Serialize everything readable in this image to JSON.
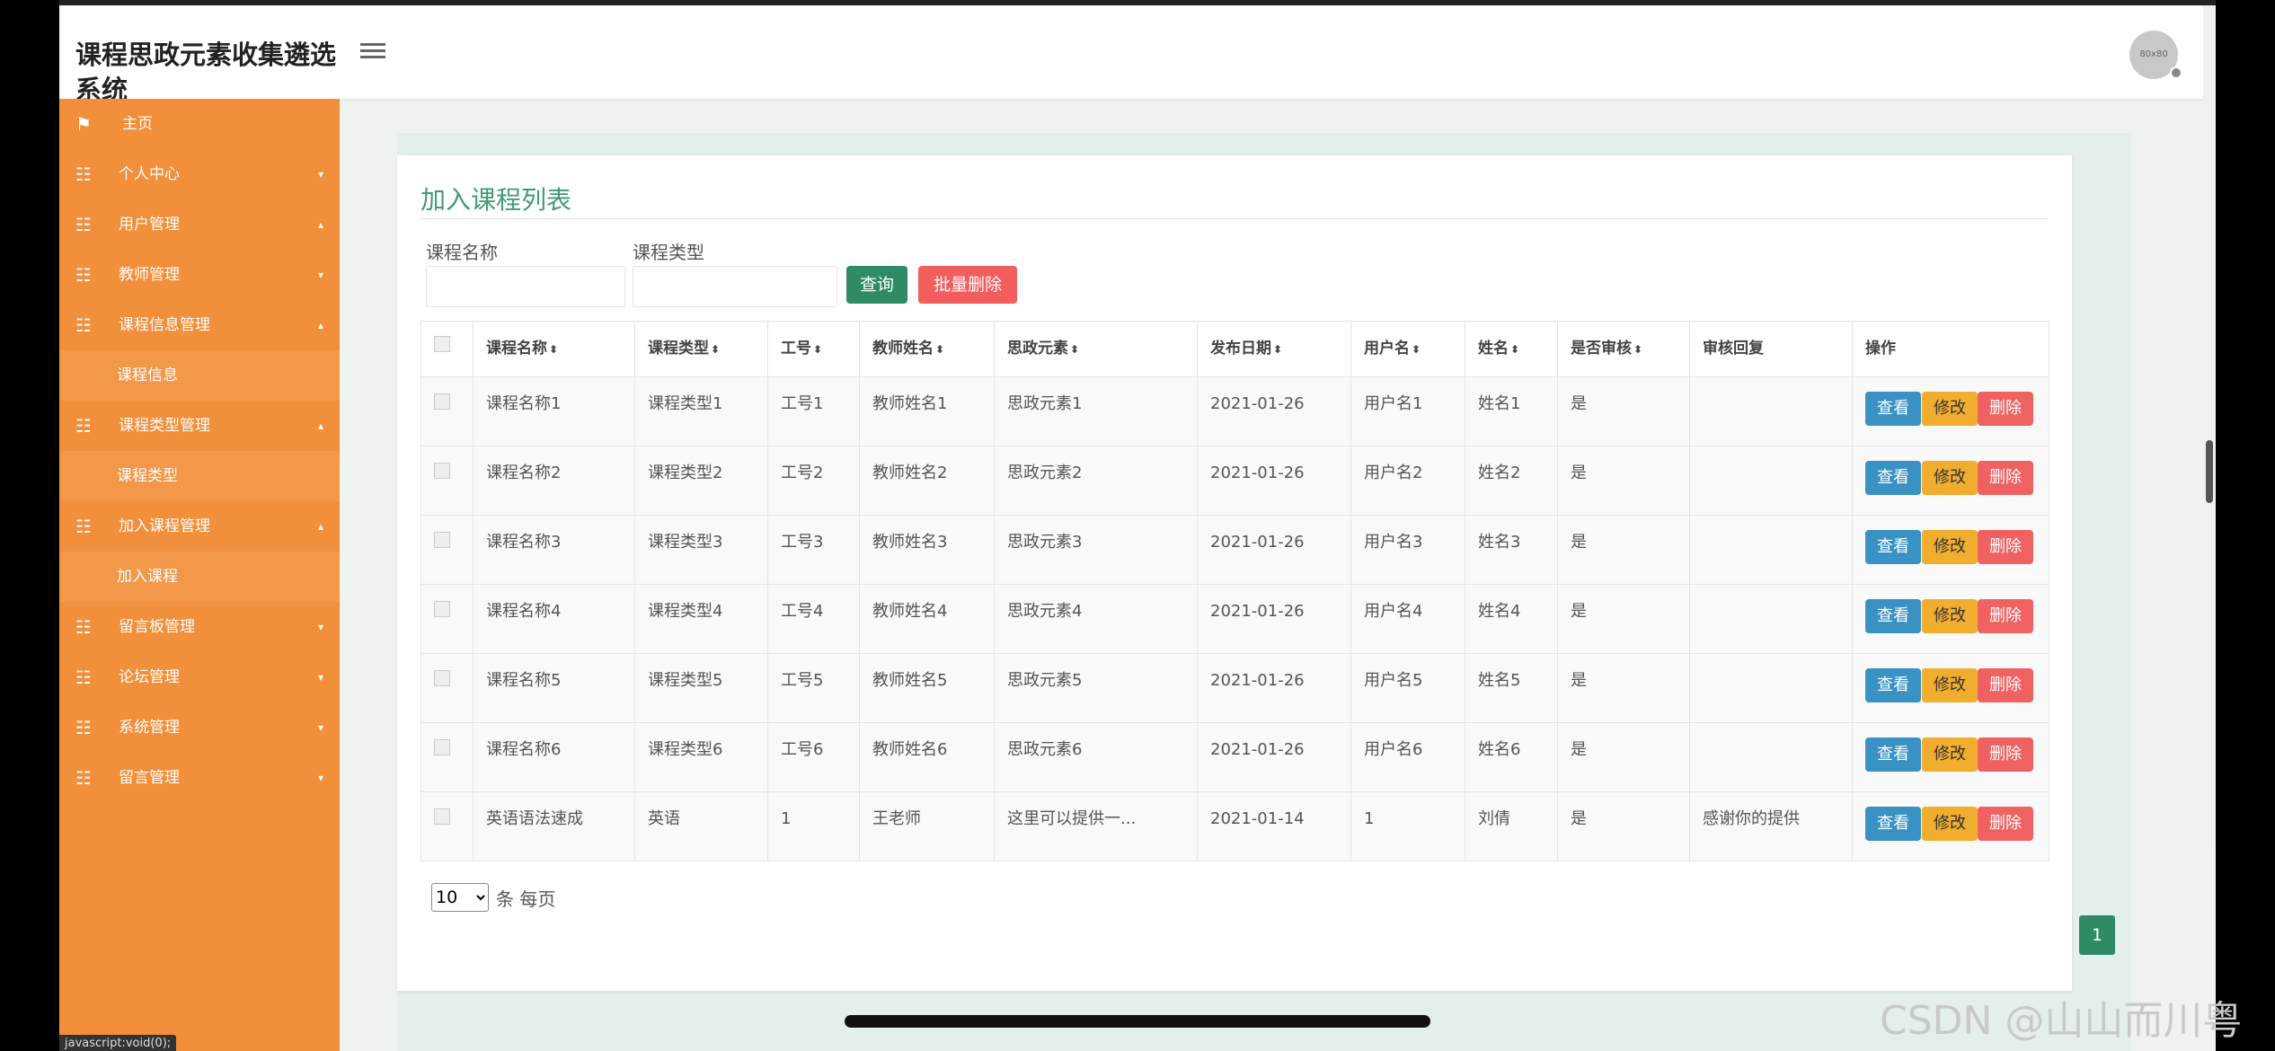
{
  "app": {
    "title": "课程思政元素收集遴选系统",
    "avatar_text": "80x80",
    "status_tip": "javascript:void(0);"
  },
  "sidebar": {
    "items": [
      {
        "label": "主页",
        "type": "top",
        "icon": "flag-icon"
      },
      {
        "label": "个人中心",
        "type": "group",
        "icon": "grid-icon",
        "arrow": "▾"
      },
      {
        "label": "用户管理",
        "type": "group",
        "icon": "grid-icon",
        "arrow": "▴"
      },
      {
        "label": "教师管理",
        "type": "group",
        "icon": "grid-icon",
        "arrow": "▾"
      },
      {
        "label": "课程信息管理",
        "type": "group",
        "icon": "grid-icon",
        "arrow": "▴"
      },
      {
        "label": "课程信息",
        "type": "sub"
      },
      {
        "label": "课程类型管理",
        "type": "group",
        "icon": "grid-icon",
        "arrow": "▴"
      },
      {
        "label": "课程类型",
        "type": "sub"
      },
      {
        "label": "加入课程管理",
        "type": "group",
        "icon": "grid-icon",
        "arrow": "▴"
      },
      {
        "label": "加入课程",
        "type": "sub"
      },
      {
        "label": "留言板管理",
        "type": "group",
        "icon": "grid-icon",
        "arrow": "▾"
      },
      {
        "label": "论坛管理",
        "type": "group",
        "icon": "grid-icon",
        "arrow": "▾"
      },
      {
        "label": "系统管理",
        "type": "group",
        "icon": "grid-icon",
        "arrow": "▾"
      },
      {
        "label": "留言管理",
        "type": "group",
        "icon": "grid-icon",
        "arrow": "▾"
      }
    ]
  },
  "main": {
    "title": "加入课程列表",
    "filters": {
      "course_name_label": "课程名称",
      "course_type_label": "课程类型",
      "query_label": "查询",
      "batch_delete_label": "批量删除"
    },
    "table": {
      "columns": [
        "课程名称",
        "课程类型",
        "工号",
        "教师姓名",
        "思政元素",
        "发布日期",
        "用户名",
        "姓名",
        "是否审核",
        "审核回复",
        "操作"
      ],
      "sortable": [
        true,
        true,
        true,
        true,
        true,
        true,
        true,
        true,
        true,
        false,
        false
      ],
      "sort_icon": "⬍",
      "rows": [
        [
          "课程名称1",
          "课程类型1",
          "工号1",
          "教师姓名1",
          "思政元素1",
          "2021-01-26",
          "用户名1",
          "姓名1",
          "是",
          ""
        ],
        [
          "课程名称2",
          "课程类型2",
          "工号2",
          "教师姓名2",
          "思政元素2",
          "2021-01-26",
          "用户名2",
          "姓名2",
          "是",
          ""
        ],
        [
          "课程名称3",
          "课程类型3",
          "工号3",
          "教师姓名3",
          "思政元素3",
          "2021-01-26",
          "用户名3",
          "姓名3",
          "是",
          ""
        ],
        [
          "课程名称4",
          "课程类型4",
          "工号4",
          "教师姓名4",
          "思政元素4",
          "2021-01-26",
          "用户名4",
          "姓名4",
          "是",
          ""
        ],
        [
          "课程名称5",
          "课程类型5",
          "工号5",
          "教师姓名5",
          "思政元素5",
          "2021-01-26",
          "用户名5",
          "姓名5",
          "是",
          ""
        ],
        [
          "课程名称6",
          "课程类型6",
          "工号6",
          "教师姓名6",
          "思政元素6",
          "2021-01-26",
          "用户名6",
          "姓名6",
          "是",
          ""
        ],
        [
          "英语语法速成",
          "英语",
          "1",
          "王老师",
          "这里可以提供一...",
          "2021-01-14",
          "1",
          "刘倩",
          "是",
          "感谢你的提供"
        ]
      ],
      "actions": {
        "view": "查看",
        "edit": "修改",
        "delete": "删除"
      }
    },
    "pagination": {
      "page_size": "10",
      "page_size_label": "条 每页",
      "current_page": "1"
    }
  },
  "watermark": "CSDN @山山而川粤"
}
